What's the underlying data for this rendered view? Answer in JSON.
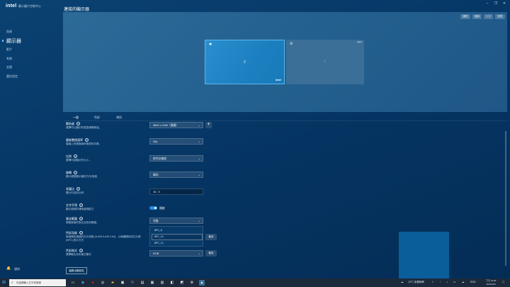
{
  "app": {
    "logo": "intel",
    "title": "顯示圖片控制中心",
    "window_controls": [
      "–",
      "❐",
      "✕"
    ]
  },
  "sidebar": {
    "items": [
      {
        "label": "首頁"
      },
      {
        "label": "顯示器",
        "active": true
      },
      {
        "label": "影片"
      },
      {
        "label": "系統"
      },
      {
        "label": "支援"
      },
      {
        "label": "喜好設定"
      }
    ],
    "notifications_label": "通知"
  },
  "main": {
    "title": "連接的顯示器",
    "preview_buttons": [
      "識別",
      "複製",
      "延伸",
      "回復"
    ],
    "monitors": [
      {
        "number": "2",
        "brand": "intel",
        "selected": true
      },
      {
        "number": "1",
        "selected": false
      }
    ],
    "tabs": [
      "一般",
      "色彩",
      "視訊"
    ]
  },
  "settings": {
    "resolution": {
      "label": "解析度",
      "desc": "選擇可以顯示的更高細節數量。",
      "value": "3840 x 2160（建議）"
    },
    "refresh": {
      "label": "重新整理速率",
      "desc": "螢幕上的畫面每秒更新的次數。",
      "value": "30p"
    },
    "scale": {
      "label": "比例",
      "desc": "選擇內容顯示的大小。",
      "value": "依完全縮放"
    },
    "rotation": {
      "label": "旋轉",
      "desc": "顯示調整顯示器的方向/角度",
      "value": "橫向"
    },
    "aspect": {
      "label": "長寬比",
      "desc": "顯示內容的比例",
      "value": "16 : 9"
    },
    "text_smoothing": {
      "label": "文字平滑",
      "desc": "顯示邊緣的清晰處理能力",
      "toggle_label": "開啟",
      "on": true
    },
    "quantization": {
      "label": "量化範圍",
      "desc": "調整畫面的對比及色彩範圍。",
      "value": "完整"
    },
    "color_depth": {
      "label": "色彩深度",
      "desc": "每個顏色通道的位元深度 (8-bit/10-bit/12-bit)，以每種顏色的位元數 (BPC) 表示方式",
      "options": [
        "8PC_8",
        "8PC_10",
        "8PC_12"
      ],
      "selected": "8PC_10",
      "apply_label": "套用"
    },
    "color_format": {
      "label": "色彩格式",
      "desc": "選擇輸出色彩格式模式",
      "value": "RGB",
      "apply_label": "套用"
    },
    "restore_label": "還原出廠設定"
  },
  "taskbar": {
    "search_placeholder": "在這裡輸入文字來搜尋",
    "weather": "12°C 多雲時晴",
    "lang": "ENG",
    "time": "下午 10:30",
    "date": "2021/2/11"
  }
}
